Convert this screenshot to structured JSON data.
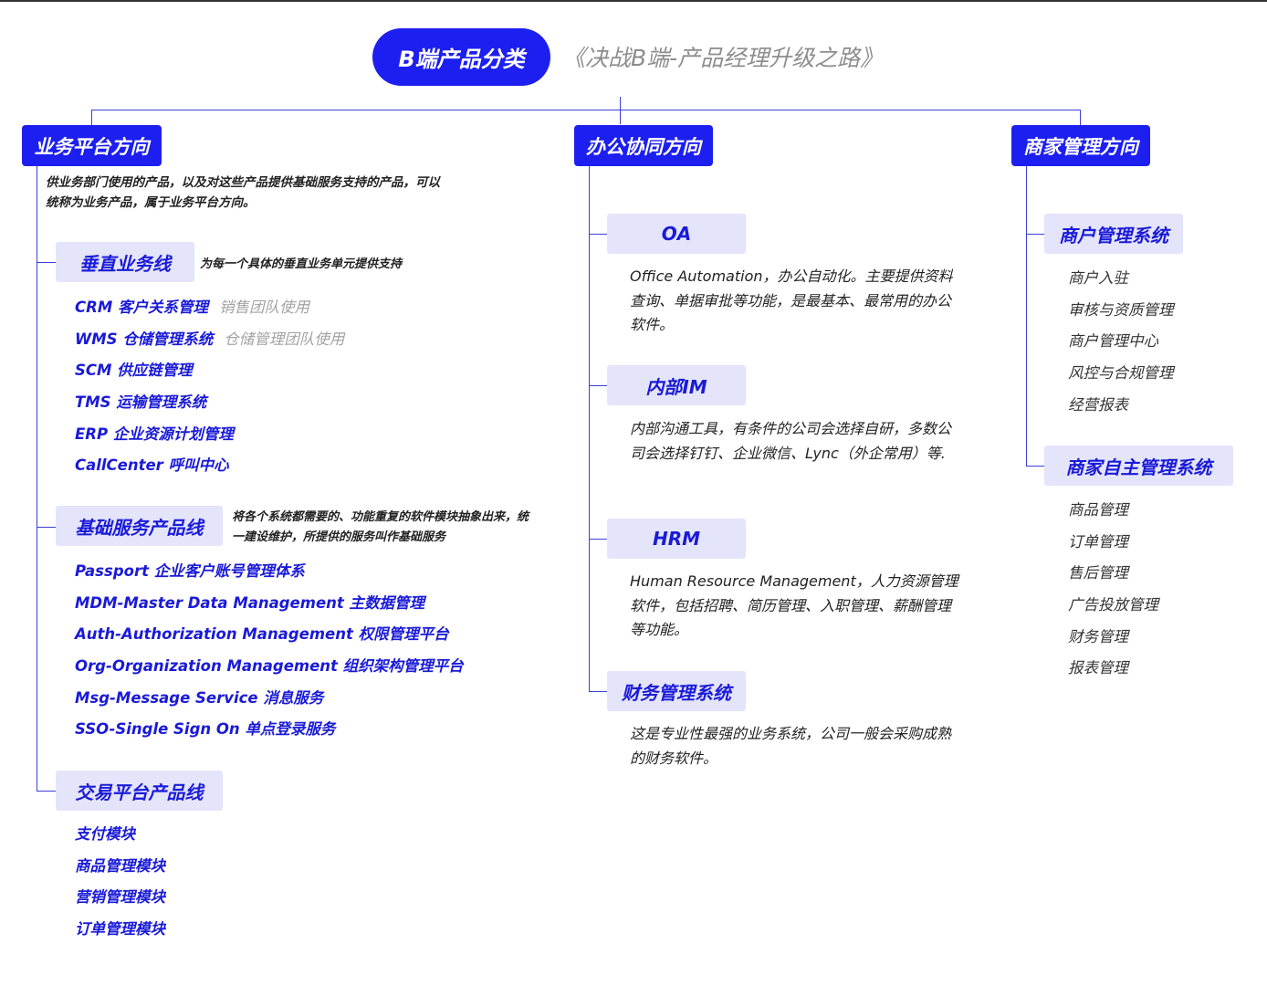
{
  "title": "B端产品分类",
  "subtitle": "《决战B端-产品经理升级之路》",
  "left": {
    "label": "业务平台方向",
    "desc": "供业务部门使用的产品，以及对这些产品提供基础服务支持的产品，可以统称为业务产品，属于业务平台方向。",
    "vertical": {
      "label": "垂直业务线",
      "note": "为每一个具体的垂直业务单元提供支持",
      "items": [
        {
          "text": "CRM 客户关系管理",
          "hint": "销售团队使用"
        },
        {
          "text": "WMS 仓储管理系统",
          "hint": "仓储管理团队使用"
        },
        {
          "text": "SCM 供应链管理",
          "hint": ""
        },
        {
          "text": "TMS 运输管理系统",
          "hint": ""
        },
        {
          "text": "ERP 企业资源计划管理",
          "hint": ""
        },
        {
          "text": "CallCenter 呼叫中心",
          "hint": ""
        }
      ]
    },
    "basic": {
      "label": "基础服务产品线",
      "note": "将各个系统都需要的、功能重复的软件模块抽象出来，统一建设维护，所提供的服务叫作基础服务",
      "items": [
        {
          "text": "Passport 企业客户账号管理体系"
        },
        {
          "text": "MDM-Master Data Management 主数据管理"
        },
        {
          "text": "Auth-Authorization Management 权限管理平台"
        },
        {
          "text": "Org-Organization Management 组织架构管理平台"
        },
        {
          "text": "Msg-Message Service 消息服务"
        },
        {
          "text": "SSO-Single Sign On 单点登录服务"
        }
      ]
    },
    "trade": {
      "label": "交易平台产品线",
      "items": [
        {
          "text": "支付模块"
        },
        {
          "text": "商品管理模块"
        },
        {
          "text": "营销管理模块"
        },
        {
          "text": "订单管理模块"
        }
      ]
    }
  },
  "middle": {
    "label": "办公协同方向",
    "sections": [
      {
        "label": "OA",
        "desc": "Office Automation，办公自动化。主要提供资料查询、单据审批等功能，是最基本、最常用的办公软件。"
      },
      {
        "label": "内部IM",
        "desc": "内部沟通工具，有条件的公司会选择自研，多数公司会选择钉钉、企业微信、Lync（外企常用）等."
      },
      {
        "label": "HRM",
        "desc": "Human Resource Management，人力资源管理软件，包括招聘、简历管理、入职管理、薪酬管理等功能。"
      },
      {
        "label": "财务管理系统",
        "desc": "这是专业性最强的业务系统，公司一般会采购成熟的财务软件。"
      }
    ]
  },
  "right": {
    "label": "商家管理方向",
    "merchant": {
      "label": "商户管理系统",
      "items": [
        {
          "text": "商户入驻"
        },
        {
          "text": "审核与资质管理"
        },
        {
          "text": "商户管理中心"
        },
        {
          "text": "风控与合规管理"
        },
        {
          "text": "经营报表"
        }
      ]
    },
    "self": {
      "label": "商家自主管理系统",
      "items": [
        {
          "text": "商品管理"
        },
        {
          "text": "订单管理"
        },
        {
          "text": "售后管理"
        },
        {
          "text": "广告投放管理"
        },
        {
          "text": "财务管理"
        },
        {
          "text": "报表管理"
        }
      ]
    }
  }
}
